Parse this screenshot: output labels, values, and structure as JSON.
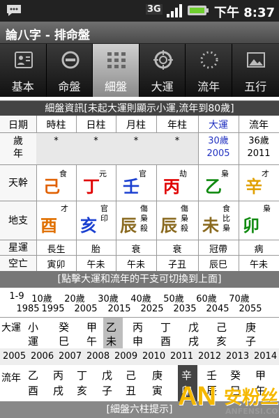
{
  "status_bar": {
    "network": "3G",
    "time": "下午 8:37"
  },
  "title": "論八字 - 排命盤",
  "tabs": [
    {
      "label": "基本",
      "icon": "person-card-icon",
      "active": false
    },
    {
      "label": "命盤",
      "icon": "theta-circle-icon",
      "active": false
    },
    {
      "label": "細盤",
      "icon": "grid-chart-icon",
      "active": true
    },
    {
      "label": "大運",
      "icon": "compass-icon",
      "active": false
    },
    {
      "label": "流年",
      "icon": "dotted-ring-icon",
      "active": false
    },
    {
      "label": "五行",
      "icon": "landscape-icon",
      "active": false
    }
  ],
  "detail_header": "細盤資訊[未起大運則顯示小運,流年到80歲]",
  "columns": [
    "日期",
    "時柱",
    "日柱",
    "月柱",
    "年柱",
    "大運",
    "流年"
  ],
  "age_row": {
    "label": "歲年",
    "values": [
      "*",
      "*",
      "*",
      "*",
      "30歲\n2005",
      "36歲\n2011"
    ]
  },
  "stem_row": {
    "label": "天幹",
    "items": [
      {
        "char": "己",
        "note": "食",
        "color": "#e06000"
      },
      {
        "char": "丁",
        "note": "元",
        "color": "#e00000"
      },
      {
        "char": "壬",
        "note": "官",
        "color": "#1a3fd0"
      },
      {
        "char": "丙",
        "note": "劫",
        "color": "#e00000"
      },
      {
        "char": "乙",
        "note": "梟",
        "color": "#108a10"
      },
      {
        "char": "辛",
        "note": "才",
        "color": "#e0a000"
      }
    ]
  },
  "branch_row": {
    "label": "地支",
    "items": [
      {
        "char": "酉",
        "notes": [
          "才"
        ],
        "color": "#e07000"
      },
      {
        "char": "亥",
        "notes": [
          "官",
          "印"
        ],
        "color": "#1a3fd0"
      },
      {
        "char": "辰",
        "notes": [
          "傷",
          "梟",
          "殺"
        ],
        "color": "#8a6a20"
      },
      {
        "char": "辰",
        "notes": [
          "傷",
          "梟",
          "殺"
        ],
        "color": "#8a6a20"
      },
      {
        "char": "未",
        "notes": [
          "食",
          "比",
          "梟"
        ],
        "color": "#8a6a20"
      },
      {
        "char": "卯",
        "notes": [
          "梟"
        ],
        "color": "#108a10"
      }
    ]
  },
  "star_row": {
    "label": "星運",
    "values": [
      "長生",
      "胎",
      "衰",
      "衰",
      "冠帶",
      "病"
    ]
  },
  "empty_row": {
    "label": "空亡",
    "values": [
      "寅卯",
      "午未",
      "午未",
      "子丑",
      "辰巳",
      "午未"
    ]
  },
  "hint_bar": "[點擊大運和流年的干支可切換到上面]",
  "dayun_ages": [
    "1-9",
    "10歲",
    "20歲",
    "30歲",
    "40歲",
    "50歲",
    "60歲",
    "70歲"
  ],
  "dayun_years": [
    "",
    "1985",
    "1995",
    "2005",
    "2015",
    "2025",
    "2035",
    "2045",
    "2055"
  ],
  "dayun_row": {
    "label": "大運",
    "items": [
      {
        "top": "小",
        "bottom": "運",
        "selected": false
      },
      {
        "top": "癸",
        "bottom": "巳",
        "selected": false
      },
      {
        "top": "甲",
        "bottom": "午",
        "selected": false
      },
      {
        "top": "乙",
        "bottom": "未",
        "selected": true
      },
      {
        "top": "丙",
        "bottom": "申",
        "selected": false
      },
      {
        "top": "丁",
        "bottom": "酉",
        "selected": false
      },
      {
        "top": "戊",
        "bottom": "戌",
        "selected": false
      },
      {
        "top": "己",
        "bottom": "亥",
        "selected": false
      },
      {
        "top": "庚",
        "bottom": "子",
        "selected": false
      }
    ]
  },
  "liunian_years": [
    "2005",
    "2006",
    "2007",
    "2008",
    "2009",
    "2010",
    "2011",
    "2012",
    "2013",
    "2014"
  ],
  "liunian_row": {
    "label": "流年",
    "items": [
      {
        "top": "乙",
        "bottom": "酉",
        "selected": false
      },
      {
        "top": "丙",
        "bottom": "戌",
        "selected": false
      },
      {
        "top": "丁",
        "bottom": "亥",
        "selected": false
      },
      {
        "top": "戊",
        "bottom": "子",
        "selected": false
      },
      {
        "top": "己",
        "bottom": "丑",
        "selected": false
      },
      {
        "top": "庚",
        "bottom": "寅",
        "selected": false
      },
      {
        "top": "辛",
        "bottom": "卯",
        "selected": true
      },
      {
        "top": "壬",
        "bottom": "辰",
        "selected": false
      },
      {
        "top": "癸",
        "bottom": "巳",
        "selected": false
      },
      {
        "top": "甲",
        "bottom": "午",
        "selected": false
      }
    ]
  },
  "bottom_bar": "[細盤六柱提示]",
  "watermark": {
    "logo": "AN",
    "cn": "安粉丝",
    "url": "ANFENSI.COM"
  }
}
